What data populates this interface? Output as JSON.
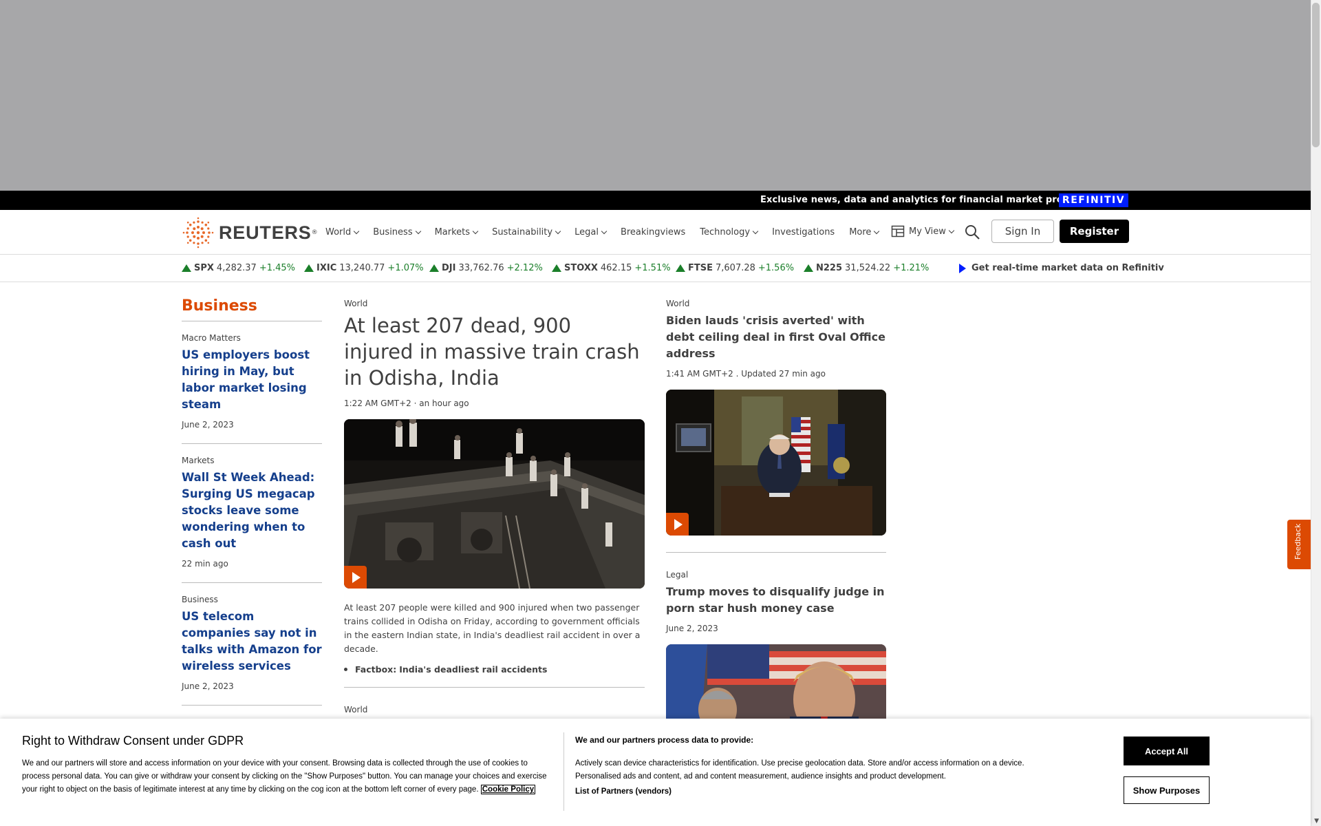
{
  "promo": {
    "text": "Exclusive news, data and analytics for financial market professionals",
    "brand": "REFINITIV"
  },
  "header": {
    "logo_text": "REUTERS",
    "logo_mark": "®",
    "nav": [
      {
        "label": "World",
        "dropdown": true
      },
      {
        "label": "Business",
        "dropdown": true
      },
      {
        "label": "Markets",
        "dropdown": true
      },
      {
        "label": "Sustainability",
        "dropdown": true
      },
      {
        "label": "Legal",
        "dropdown": true
      },
      {
        "label": "Breakingviews",
        "dropdown": false
      },
      {
        "label": "Technology",
        "dropdown": true
      },
      {
        "label": "Investigations",
        "dropdown": false
      },
      {
        "label": "More",
        "dropdown": true
      }
    ],
    "my_view": "My View",
    "sign_in": "Sign In",
    "register": "Register"
  },
  "ticker": {
    "items": [
      {
        "symbol": "SPX",
        "value": "4,282.37",
        "change": "+1.45%"
      },
      {
        "symbol": "IXIC",
        "value": "13,240.77",
        "change": "+1.07%"
      },
      {
        "symbol": "DJI",
        "value": "33,762.76",
        "change": "+2.12%"
      },
      {
        "symbol": "STOXX",
        "value": "462.15",
        "change": "+1.51%"
      },
      {
        "symbol": "FTSE",
        "value": "7,607.28",
        "change": "+1.56%"
      },
      {
        "symbol": "N225",
        "value": "31,524.22",
        "change": "+1.21%"
      }
    ],
    "realtime_link": "Get real-time market data on Refinitiv"
  },
  "section": {
    "title": "Business"
  },
  "left_stories": [
    {
      "kicker": "Macro Matters",
      "headline": "US employers boost hiring in May, but labor market losing steam",
      "time": "June 2, 2023"
    },
    {
      "kicker": "Markets",
      "headline": "Wall St Week Ahead: Surging US megacap stocks leave some wondering when to cash out",
      "time": "22 min ago"
    },
    {
      "kicker": "Business",
      "headline": "US telecom companies say not in talks with Amazon for wireless services",
      "time": "June 2, 2023"
    }
  ],
  "main_story": {
    "kicker": "World",
    "headline": "At least 207 dead, 900 injured in massive train crash in Odisha, India",
    "time": "1:22 AM GMT+2 · an hour ago",
    "summary": "At least 207 people were killed and 900 injured when two passenger trains collided in Odisha on Friday, according to government officials in the eastern Indian state, in India's deadliest rail accident in over a decade.",
    "factbox_prefix": "Factbox:",
    "factbox_text": "India's deadliest rail accidents",
    "next_kicker": "World"
  },
  "right_stories": [
    {
      "kicker": "World",
      "headline": "Biden lauds 'crisis averted' with debt ceiling deal in first Oval Office address",
      "time": "1:41 AM GMT+2 . Updated 27 min ago"
    },
    {
      "kicker": "Legal",
      "headline": "Trump moves to disqualify judge in porn star hush money case",
      "time": "June 2, 2023"
    }
  ],
  "feedback": {
    "label": "Feedback"
  },
  "gdpr": {
    "title": "Right to Withdraw Consent under GDPR",
    "body": "We and our partners will store and access information on your device with your consent. Browsing data is collected through the use of cookies to process personal data. You can give or withdraw your consent by clicking on the \"Show Purposes\" button. You can manage your choices and exercise your right to object on the basis of legitimate interest at any time by clicking on the cog icon at the bottom left corner of every page.",
    "cookie_link": "Cookie Policy",
    "right_title": "We and our partners process data to provide:",
    "right_body": "Actively scan device characteristics for identification. Use precise geolocation data. Store and/or access information on a device. Personalised ads and content, ad and content measurement, audience insights and product development.",
    "partners": "List of Partners (vendors)",
    "accept": "Accept All",
    "show_purposes": "Show Purposes"
  },
  "colors": {
    "accent": "#dc4a03",
    "link_blue": "#153f8c",
    "ticker_up": "#1b7f2a",
    "refinitiv_blue": "#001eff"
  }
}
